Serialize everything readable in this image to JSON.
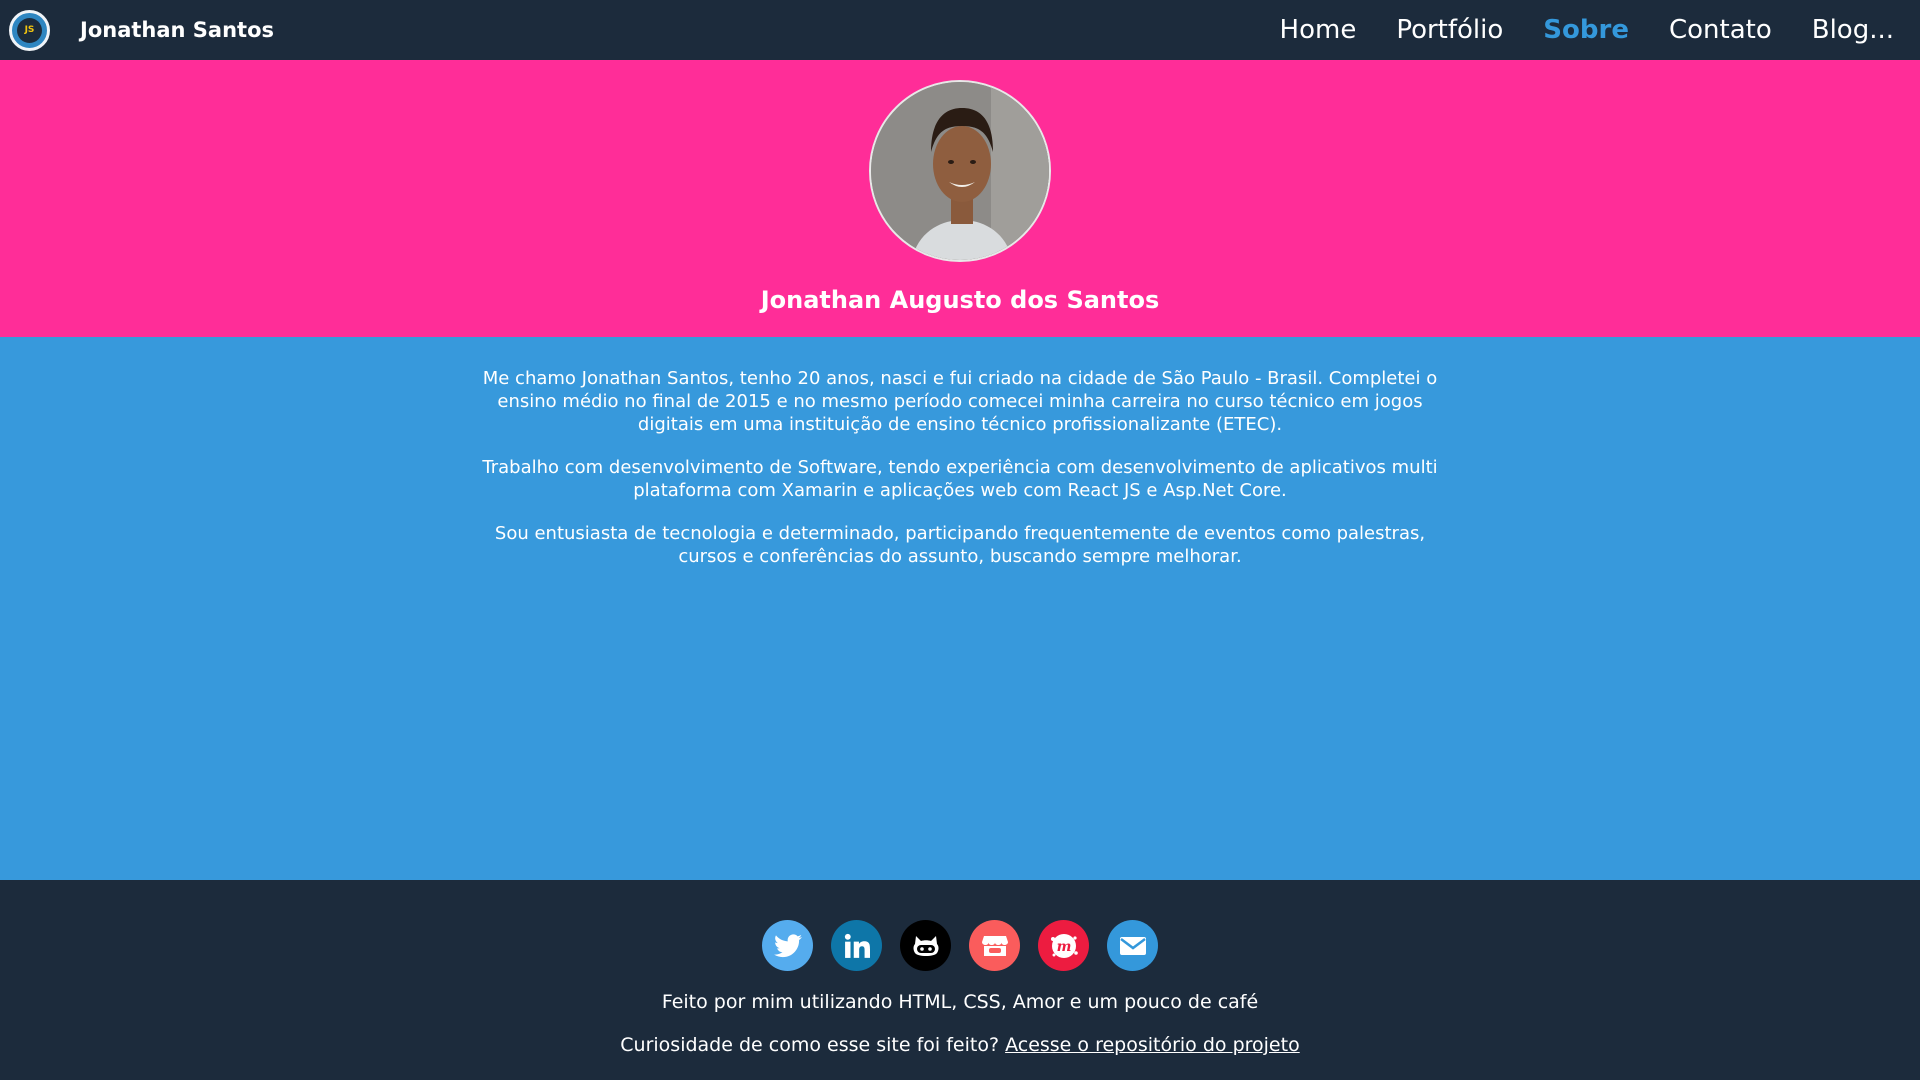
{
  "brand": {
    "name": "Jonathan Santos",
    "logo_text": "JS"
  },
  "nav": {
    "items": [
      {
        "label": "Home",
        "active": false
      },
      {
        "label": "Portfólio",
        "active": false
      },
      {
        "label": "Sobre",
        "active": true
      },
      {
        "label": "Contato",
        "active": false
      },
      {
        "label": "Blog...",
        "active": false
      }
    ]
  },
  "hero": {
    "name": "Jonathan Augusto dos Santos"
  },
  "about": {
    "paragraphs": [
      "Me chamo Jonathan Santos, tenho 20 anos, nasci e fui criado na cidade de São Paulo - Brasil. Completei o ensino médio no final de 2015 e no mesmo período comecei minha carreira no curso técnico em jogos digitais em uma instituição de ensino técnico profissionalizante (ETEC).",
      "Trabalho com desenvolvimento de Software, tendo experiência com desenvolvimento de aplicativos multi plataforma com Xamarin e aplicações web com React JS e Asp.Net Core.",
      "Sou entusiasta de tecnologia e determinado, participando frequentemente de eventos como palestras, cursos e conferências do assunto, buscando sempre melhorar."
    ]
  },
  "footer": {
    "social": [
      {
        "icon": "twitter-icon",
        "color": "#55acee"
      },
      {
        "icon": "linkedin-icon",
        "color": "#0e76a8"
      },
      {
        "icon": "github-icon",
        "color": "#000000"
      },
      {
        "icon": "itchio-icon",
        "color": "#fa5c5c"
      },
      {
        "icon": "meetup-icon",
        "color": "#ed1c40"
      },
      {
        "icon": "email-icon",
        "color": "#3498db"
      }
    ],
    "made_with": "Feito por mim utilizando HTML, CSS, Amor e um pouco de café",
    "curiosity": "Curiosidade de como esse site foi feito?",
    "repo_link": "Acesse o repositório do projeto"
  },
  "colors": {
    "navbar": "#1c2b3c",
    "accent": "#3498db",
    "hero": "#ff2d98"
  }
}
